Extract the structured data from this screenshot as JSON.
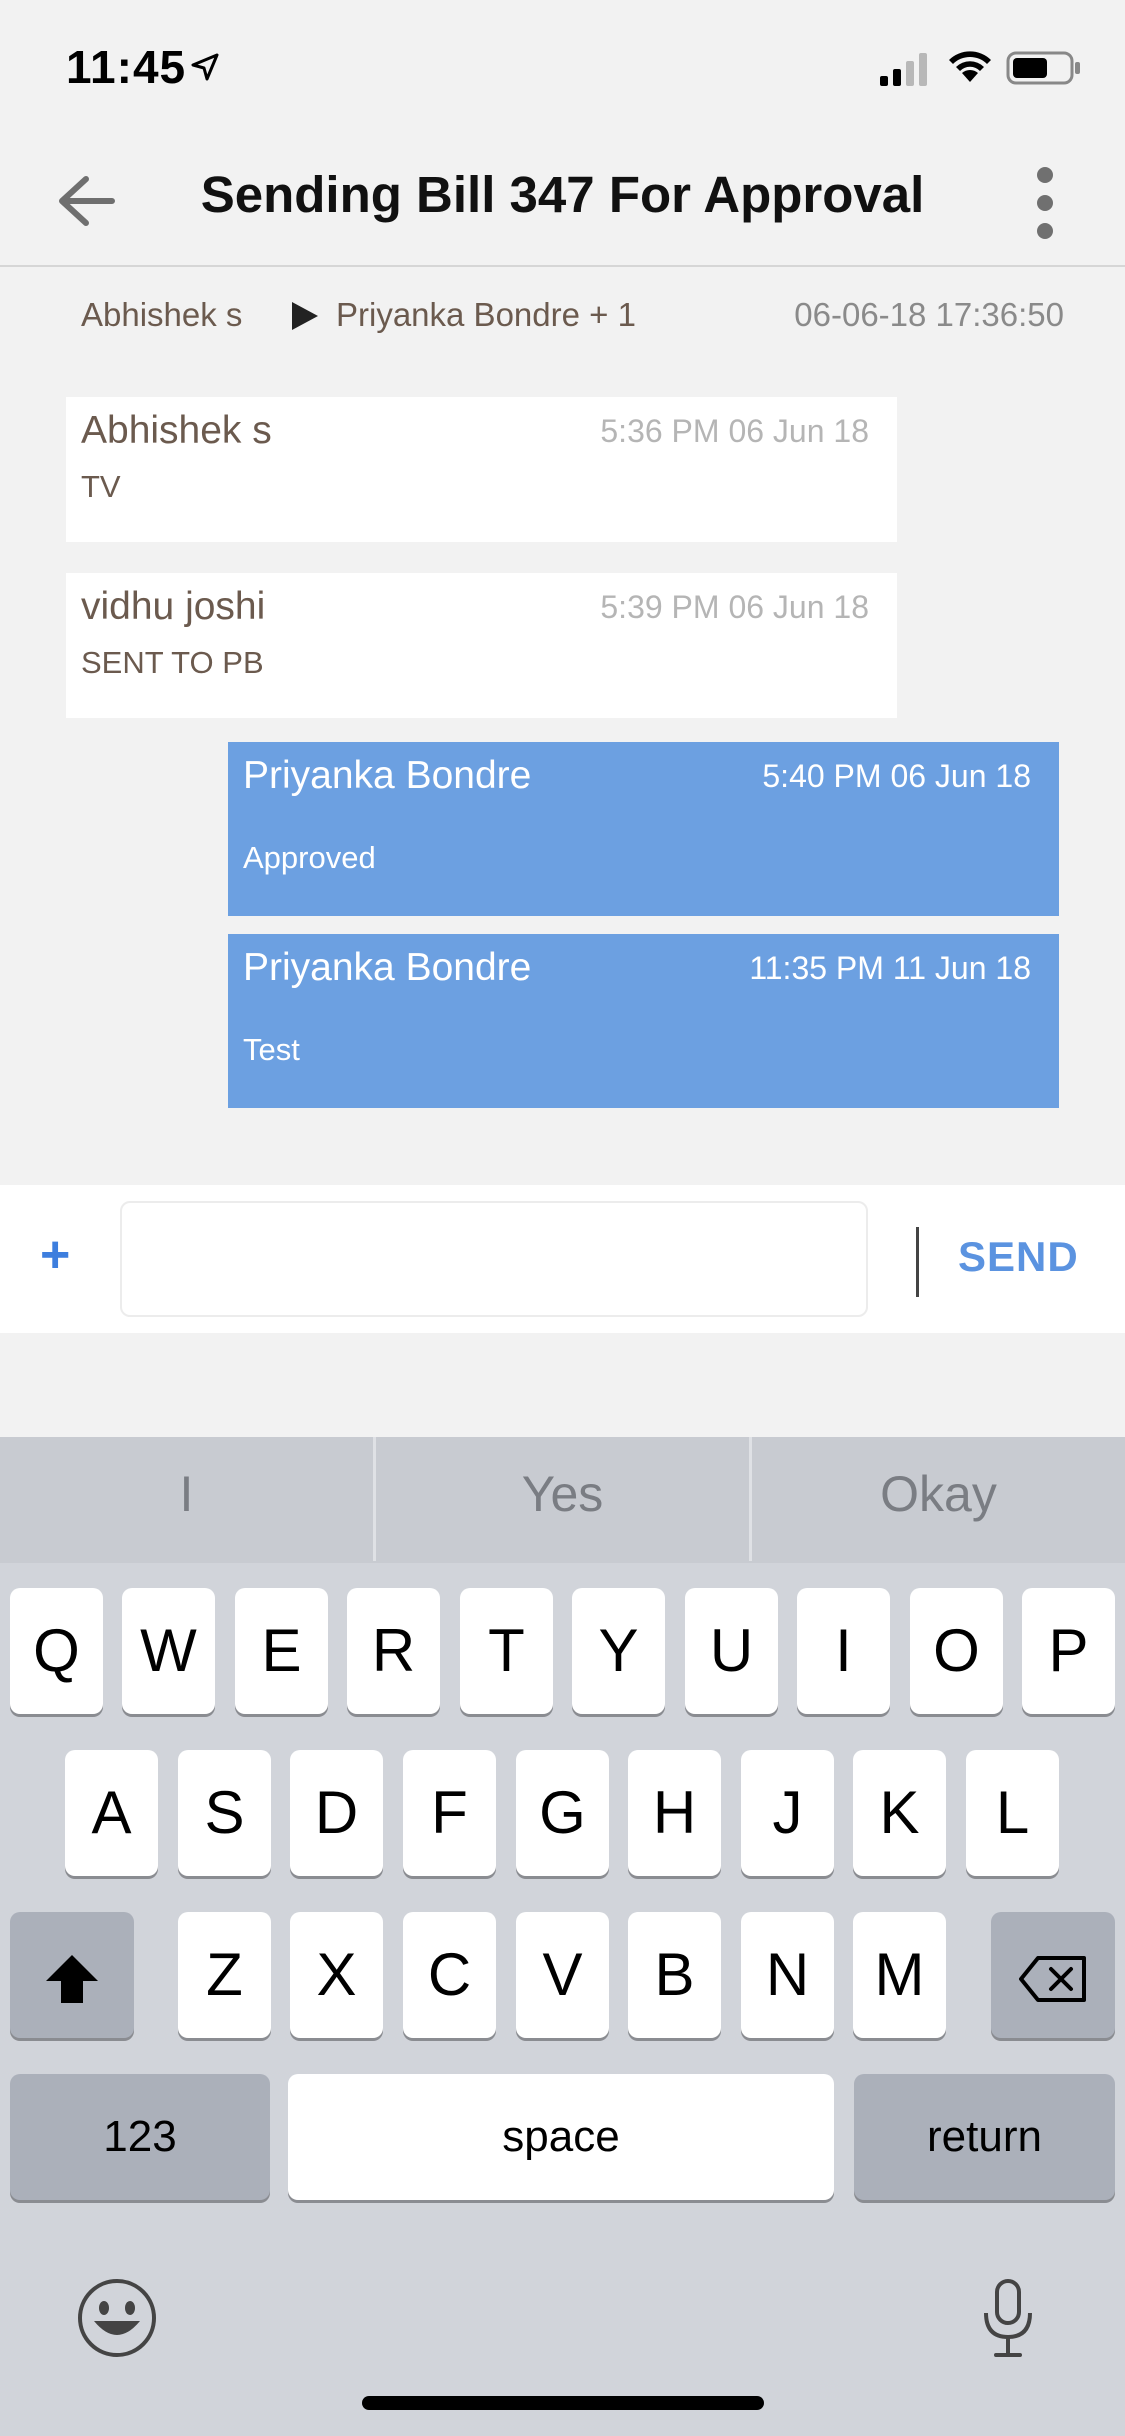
{
  "status_bar": {
    "time": "11:45"
  },
  "nav": {
    "title": "Sending Bill 347 For Approval"
  },
  "thread": {
    "from": "Abhishek s",
    "to": "Priyanka Bondre + 1",
    "timestamp": "06-06-18 17:36:50"
  },
  "messages": [
    {
      "sender": "Abhishek s",
      "time": "5:36 PM 06 Jun 18",
      "text": "TV",
      "direction": "in"
    },
    {
      "sender": "vidhu joshi",
      "time": "5:39 PM 06 Jun 18",
      "text": "SENT TO PB",
      "direction": "in"
    },
    {
      "sender": "Priyanka Bondre",
      "time": "5:40 PM 06 Jun 18",
      "text": "Approved",
      "direction": "out"
    },
    {
      "sender": "Priyanka Bondre",
      "time": "11:35 PM 11 Jun 18",
      "text": "Test",
      "direction": "out"
    }
  ],
  "composer": {
    "attach_label": "+",
    "input_value": "",
    "send_label": "SEND"
  },
  "keyboard": {
    "suggestions": [
      "I",
      "Yes",
      "Okay"
    ],
    "row1": [
      "Q",
      "W",
      "E",
      "R",
      "T",
      "Y",
      "U",
      "I",
      "O",
      "P"
    ],
    "row2": [
      "A",
      "S",
      "D",
      "F",
      "G",
      "H",
      "J",
      "K",
      "L"
    ],
    "row3": [
      "Z",
      "X",
      "C",
      "V",
      "B",
      "N",
      "M"
    ],
    "numbers_label": "123",
    "space_label": "space",
    "return_label": "return"
  },
  "colors": {
    "outgoing_bubble": "#6ca0e1",
    "accent": "#3d7ede",
    "incoming_text": "#6b5a4e"
  }
}
